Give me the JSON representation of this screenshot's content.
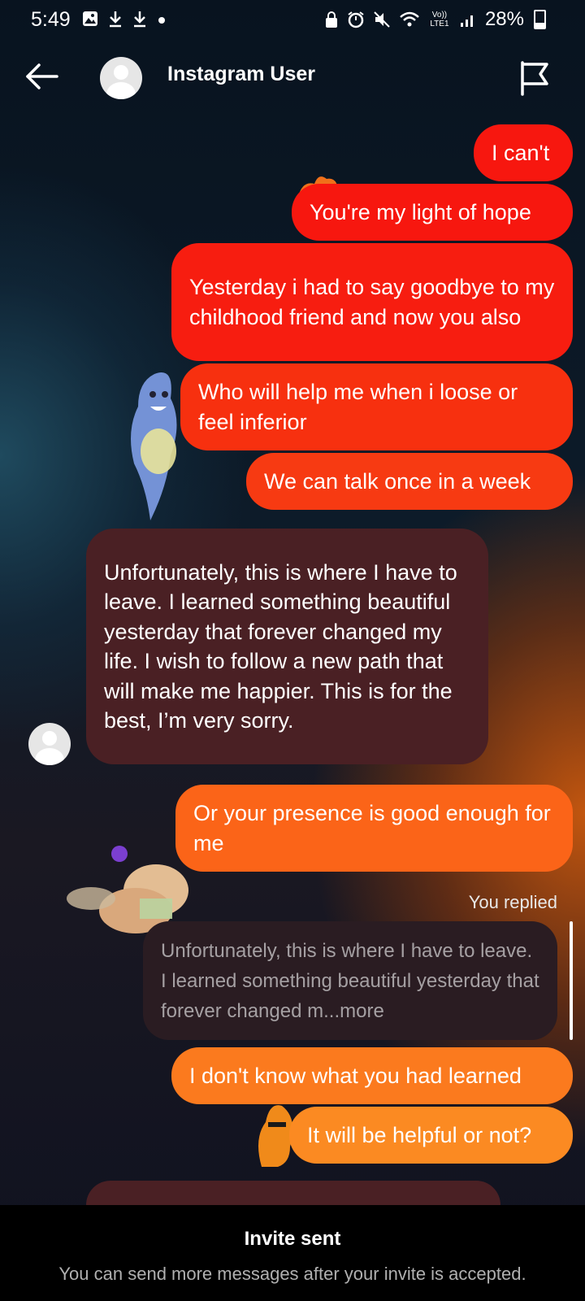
{
  "status_bar": {
    "time": "5:49",
    "battery": "28%",
    "icons_left": [
      "gallery-icon",
      "download-icon",
      "download-icon",
      "dot-icon"
    ],
    "icons_right": [
      "lock-icon",
      "alarm-icon",
      "mute-icon",
      "wifi-icon",
      "volte-icon",
      "signal-icon",
      "battery-icon"
    ],
    "volte_text": "Vo)) LTE1"
  },
  "header": {
    "title": "Instagram User"
  },
  "messages": [
    {
      "from": "me",
      "text": "I can't",
      "color": "#f7170f"
    },
    {
      "from": "me",
      "text": "You're my light of hope",
      "color": "#f7170f"
    },
    {
      "from": "me",
      "text": "Yesterday i had to say goodbye to my childhood friend and now you also",
      "color": "#f71d10"
    },
    {
      "from": "me",
      "text": "Who will help me when i loose or feel inferior",
      "color": "#f7300f"
    },
    {
      "from": "me",
      "text": "We can talk once in a week",
      "color": "#f73a12"
    },
    {
      "from": "them",
      "text": "Unfortunately, this is where I have to leave. I learned something beautiful yesterday that forever changed my life. I wish to follow a new path that will make me happier. This is for the best, I’m very sorry.",
      "color": "#4a2024"
    },
    {
      "from": "me",
      "text": "Or your presence is good enough for me",
      "color": "#fb6418"
    },
    {
      "from": "me",
      "text": "I don't know what you had learned",
      "color": "#fb7a1e"
    },
    {
      "from": "me",
      "text": "It will be helpful or not?",
      "color": "#fb8a22"
    }
  ],
  "reply": {
    "label": "You replied",
    "quote": "Unfortunately, this is where I have to leave. I learned something beautiful yesterday that forever changed m...more"
  },
  "footer": {
    "title": "Invite sent",
    "subtitle": "You can send more messages after your invite is accepted."
  }
}
